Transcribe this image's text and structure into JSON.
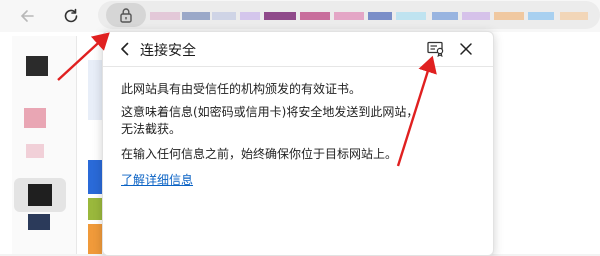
{
  "popup": {
    "title": "连接安全",
    "paragraphs": [
      "此网站具有由受信任的机构颁发的有效证书。",
      "这意味着信息(如密码或信用卡)将安全地发送到此网站，无法截获。",
      "在输入任何信息之前，始终确保你位于目标网站上。"
    ],
    "link_label": "了解详细信息"
  },
  "icons": {
    "back": "back-arrow-icon",
    "refresh": "refresh-icon",
    "lock": "lock-icon",
    "popup_back": "chevron-left-icon",
    "certificate": "certificate-icon",
    "close": "close-icon"
  },
  "colors": {
    "annotation": "#e02020",
    "link": "#0a62c4",
    "lock_pill": "#d6d6d6"
  }
}
